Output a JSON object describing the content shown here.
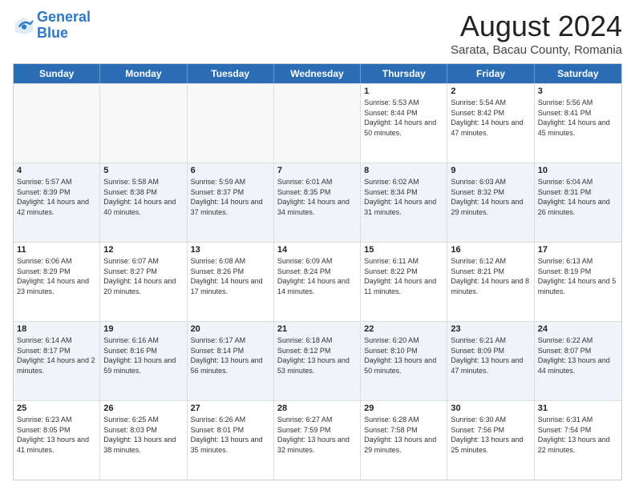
{
  "header": {
    "logo_line1": "General",
    "logo_line2": "Blue",
    "main_title": "August 2024",
    "subtitle": "Sarata, Bacau County, Romania"
  },
  "days_of_week": [
    "Sunday",
    "Monday",
    "Tuesday",
    "Wednesday",
    "Thursday",
    "Friday",
    "Saturday"
  ],
  "weeks": [
    [
      {
        "day": "",
        "info": ""
      },
      {
        "day": "",
        "info": ""
      },
      {
        "day": "",
        "info": ""
      },
      {
        "day": "",
        "info": ""
      },
      {
        "day": "1",
        "info": "Sunrise: 5:53 AM\nSunset: 8:44 PM\nDaylight: 14 hours and 50 minutes."
      },
      {
        "day": "2",
        "info": "Sunrise: 5:54 AM\nSunset: 8:42 PM\nDaylight: 14 hours and 47 minutes."
      },
      {
        "day": "3",
        "info": "Sunrise: 5:56 AM\nSunset: 8:41 PM\nDaylight: 14 hours and 45 minutes."
      }
    ],
    [
      {
        "day": "4",
        "info": "Sunrise: 5:57 AM\nSunset: 8:39 PM\nDaylight: 14 hours and 42 minutes."
      },
      {
        "day": "5",
        "info": "Sunrise: 5:58 AM\nSunset: 8:38 PM\nDaylight: 14 hours and 40 minutes."
      },
      {
        "day": "6",
        "info": "Sunrise: 5:59 AM\nSunset: 8:37 PM\nDaylight: 14 hours and 37 minutes."
      },
      {
        "day": "7",
        "info": "Sunrise: 6:01 AM\nSunset: 8:35 PM\nDaylight: 14 hours and 34 minutes."
      },
      {
        "day": "8",
        "info": "Sunrise: 6:02 AM\nSunset: 8:34 PM\nDaylight: 14 hours and 31 minutes."
      },
      {
        "day": "9",
        "info": "Sunrise: 6:03 AM\nSunset: 8:32 PM\nDaylight: 14 hours and 29 minutes."
      },
      {
        "day": "10",
        "info": "Sunrise: 6:04 AM\nSunset: 8:31 PM\nDaylight: 14 hours and 26 minutes."
      }
    ],
    [
      {
        "day": "11",
        "info": "Sunrise: 6:06 AM\nSunset: 8:29 PM\nDaylight: 14 hours and 23 minutes."
      },
      {
        "day": "12",
        "info": "Sunrise: 6:07 AM\nSunset: 8:27 PM\nDaylight: 14 hours and 20 minutes."
      },
      {
        "day": "13",
        "info": "Sunrise: 6:08 AM\nSunset: 8:26 PM\nDaylight: 14 hours and 17 minutes."
      },
      {
        "day": "14",
        "info": "Sunrise: 6:09 AM\nSunset: 8:24 PM\nDaylight: 14 hours and 14 minutes."
      },
      {
        "day": "15",
        "info": "Sunrise: 6:11 AM\nSunset: 8:22 PM\nDaylight: 14 hours and 11 minutes."
      },
      {
        "day": "16",
        "info": "Sunrise: 6:12 AM\nSunset: 8:21 PM\nDaylight: 14 hours and 8 minutes."
      },
      {
        "day": "17",
        "info": "Sunrise: 6:13 AM\nSunset: 8:19 PM\nDaylight: 14 hours and 5 minutes."
      }
    ],
    [
      {
        "day": "18",
        "info": "Sunrise: 6:14 AM\nSunset: 8:17 PM\nDaylight: 14 hours and 2 minutes."
      },
      {
        "day": "19",
        "info": "Sunrise: 6:16 AM\nSunset: 8:16 PM\nDaylight: 13 hours and 59 minutes."
      },
      {
        "day": "20",
        "info": "Sunrise: 6:17 AM\nSunset: 8:14 PM\nDaylight: 13 hours and 56 minutes."
      },
      {
        "day": "21",
        "info": "Sunrise: 6:18 AM\nSunset: 8:12 PM\nDaylight: 13 hours and 53 minutes."
      },
      {
        "day": "22",
        "info": "Sunrise: 6:20 AM\nSunset: 8:10 PM\nDaylight: 13 hours and 50 minutes."
      },
      {
        "day": "23",
        "info": "Sunrise: 6:21 AM\nSunset: 8:09 PM\nDaylight: 13 hours and 47 minutes."
      },
      {
        "day": "24",
        "info": "Sunrise: 6:22 AM\nSunset: 8:07 PM\nDaylight: 13 hours and 44 minutes."
      }
    ],
    [
      {
        "day": "25",
        "info": "Sunrise: 6:23 AM\nSunset: 8:05 PM\nDaylight: 13 hours and 41 minutes."
      },
      {
        "day": "26",
        "info": "Sunrise: 6:25 AM\nSunset: 8:03 PM\nDaylight: 13 hours and 38 minutes."
      },
      {
        "day": "27",
        "info": "Sunrise: 6:26 AM\nSunset: 8:01 PM\nDaylight: 13 hours and 35 minutes."
      },
      {
        "day": "28",
        "info": "Sunrise: 6:27 AM\nSunset: 7:59 PM\nDaylight: 13 hours and 32 minutes."
      },
      {
        "day": "29",
        "info": "Sunrise: 6:28 AM\nSunset: 7:58 PM\nDaylight: 13 hours and 29 minutes."
      },
      {
        "day": "30",
        "info": "Sunrise: 6:30 AM\nSunset: 7:56 PM\nDaylight: 13 hours and 25 minutes."
      },
      {
        "day": "31",
        "info": "Sunrise: 6:31 AM\nSunset: 7:54 PM\nDaylight: 13 hours and 22 minutes."
      }
    ]
  ]
}
